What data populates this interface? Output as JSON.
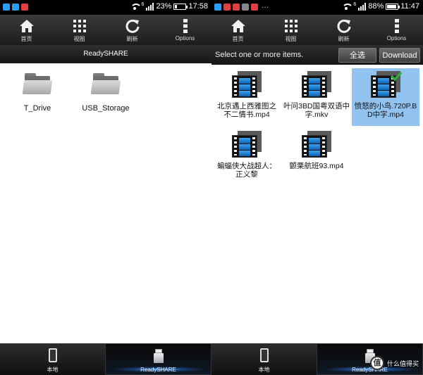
{
  "left": {
    "statusbar": {
      "wifi_superscript": "6",
      "battery_text": "23%",
      "time": "17:58",
      "battery_level": 0.23,
      "app_colors": [
        "#2a9df4",
        "#2a9df4",
        "#e04040"
      ]
    },
    "actionbar": [
      {
        "label": "首页",
        "icon": "home-icon"
      },
      {
        "label": "视图",
        "icon": "grid-icon"
      },
      {
        "label": "刷新",
        "icon": "refresh-icon"
      },
      {
        "label": "Options",
        "icon": "more-vertical-icon"
      }
    ],
    "title": "ReadySHARE",
    "folders": [
      {
        "label": "T_Drive",
        "icon": "folder-icon"
      },
      {
        "label": "USB_Storage",
        "icon": "folder-icon"
      }
    ],
    "bottom_tabs": [
      {
        "label": "本地",
        "icon": "phone-icon",
        "active": false
      },
      {
        "label": "ReadySHARE",
        "icon": "usb-drive-icon",
        "active": true
      }
    ]
  },
  "right": {
    "statusbar": {
      "wifi_superscript": "6",
      "battery_text": "88%",
      "time": "11:47",
      "battery_level": 0.88,
      "overflow": "···",
      "app_colors": [
        "#2a9df4",
        "#e04040",
        "#e04040",
        "#888888",
        "#e04040"
      ]
    },
    "actionbar": [
      {
        "label": "首页",
        "icon": "home-icon"
      },
      {
        "label": "视图",
        "icon": "grid-icon"
      },
      {
        "label": "刷新",
        "icon": "refresh-icon"
      },
      {
        "label": "Options",
        "icon": "more-vertical-icon"
      }
    ],
    "select_message": "Select one or more items.",
    "select_all_label": "全选",
    "download_label": "Download",
    "videos": [
      {
        "label": "北京遇上西雅图之不二情书.mp4",
        "selected": false
      },
      {
        "label": "叶问3BD国粤双语中字.mkv",
        "selected": false
      },
      {
        "label": "愤怒的小鸟.720P.BD中字.mp4",
        "selected": true
      },
      {
        "label": "蝙蝠侠大战超人：正义黎",
        "selected": false
      },
      {
        "label": "颤栗航班93.mp4",
        "selected": false
      }
    ],
    "bottom_tabs": [
      {
        "label": "本地",
        "icon": "phone-icon",
        "active": false
      },
      {
        "label": "ReadySHARE",
        "icon": "usb-drive-icon",
        "active": true
      }
    ]
  },
  "colors": {
    "selected_bg": "#92c2ef",
    "bar_bg": "#1c1c1c",
    "film_blue": "#1f7fd6",
    "check_green": "#2eae3c"
  },
  "watermark": {
    "badge": "值",
    "text": "什么值得买"
  }
}
